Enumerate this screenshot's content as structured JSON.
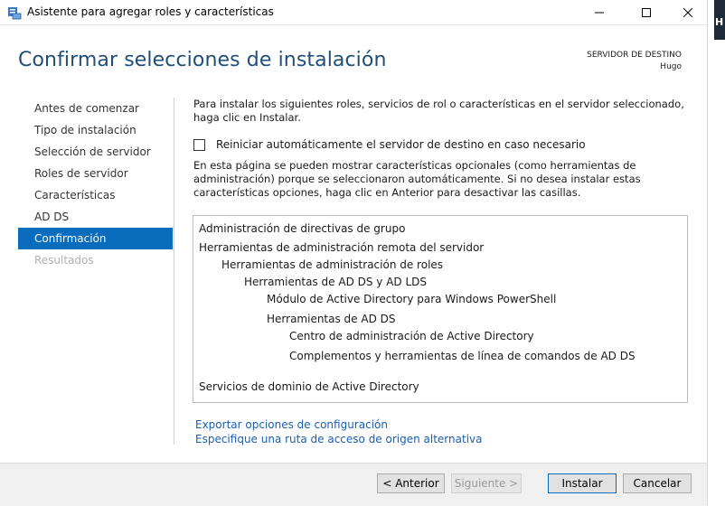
{
  "window": {
    "title": "Asistente para agregar roles y características",
    "controls": {
      "minimize": "minimize-icon",
      "maximize": "maximize-icon",
      "close": "close-icon"
    }
  },
  "side_fragment": "H",
  "header": {
    "title": "Confirmar selecciones de instalación",
    "dest_label": "SERVIDOR DE DESTINO",
    "dest_server": "Hugo"
  },
  "nav": {
    "items": [
      {
        "label": "Antes de comenzar",
        "state": "normal"
      },
      {
        "label": "Tipo de instalación",
        "state": "normal"
      },
      {
        "label": "Selección de servidor",
        "state": "normal"
      },
      {
        "label": "Roles de servidor",
        "state": "normal"
      },
      {
        "label": "Características",
        "state": "normal"
      },
      {
        "label": "AD DS",
        "state": "normal"
      },
      {
        "label": "Confirmación",
        "state": "active"
      },
      {
        "label": "Resultados",
        "state": "disabled"
      }
    ]
  },
  "content": {
    "intro": "Para instalar los siguientes roles, servicios de rol o características en el servidor seleccionado, haga clic en Instalar.",
    "restart_checkbox": {
      "label": "Reiniciar automáticamente el servidor de destino en caso necesario",
      "checked": false
    },
    "note": "En esta página se pueden mostrar características opcionales (como herramientas de administración) porque se seleccionaron automáticamente. Si no desea instalar estas características opciones, haga clic en Anterior para desactivar las casillas.",
    "features": [
      {
        "label": "Administración de directivas de grupo",
        "level": 0
      },
      {
        "label": "Herramientas de administración remota del servidor",
        "level": 0
      },
      {
        "label": "Herramientas de administración de roles",
        "level": 1
      },
      {
        "label": "Herramientas de AD DS y AD LDS",
        "level": 2
      },
      {
        "label": "Módulo de Active Directory para Windows PowerShell",
        "level": 3
      },
      {
        "label": "Herramientas de AD DS",
        "level": 3
      },
      {
        "label": "Centro de administración de Active Directory",
        "level": 4
      },
      {
        "label": "Complementos y herramientas de línea de comandos de AD DS",
        "level": 4
      },
      {
        "label": "Servicios de dominio de Active Directory",
        "level": 0
      }
    ],
    "links": {
      "export": "Exportar opciones de configuración",
      "source_path": "Especifique una ruta de acceso de origen alternativa"
    }
  },
  "footer": {
    "prev": "< Anterior",
    "next": "Siguiente >",
    "install": "Instalar",
    "cancel": "Cancelar"
  },
  "colors": {
    "accent": "#0a6cbd",
    "title": "#1e4e79",
    "link": "#1a5fb4"
  }
}
